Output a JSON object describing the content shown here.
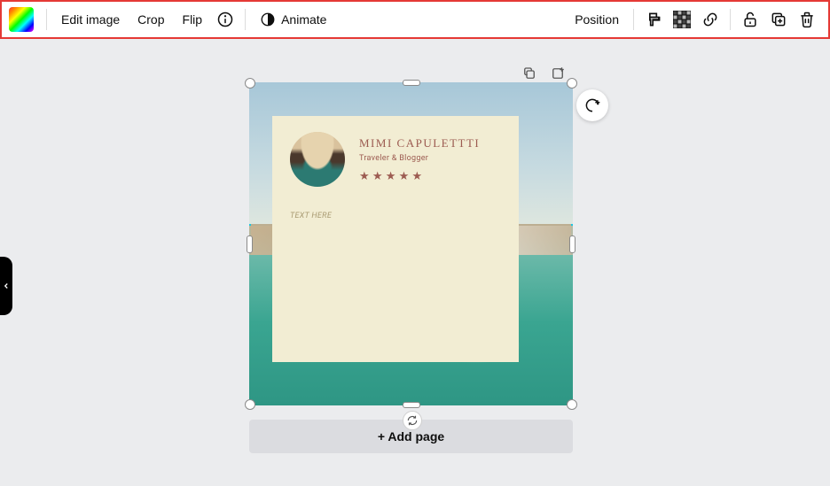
{
  "toolbar": {
    "edit_image": "Edit image",
    "crop": "Crop",
    "flip": "Flip",
    "animate": "Animate",
    "position": "Position"
  },
  "card": {
    "name": "MIMI CAPULETTTI",
    "subtitle": "Traveler & Blogger",
    "stars": "★ ★ ★ ★ ★",
    "placeholder": "TEXT HERE"
  },
  "add_page_label": "+ Add page"
}
